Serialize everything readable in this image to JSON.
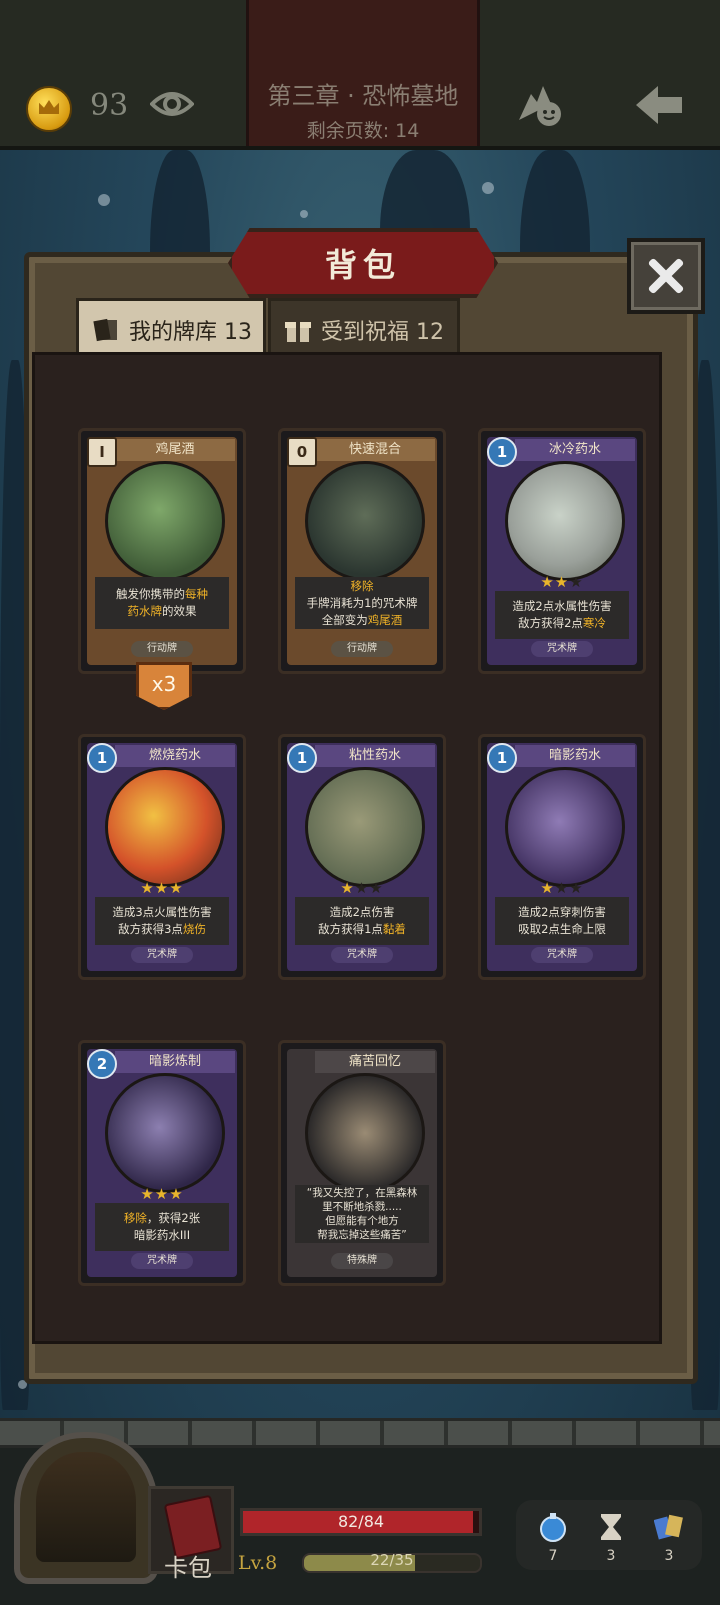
{
  "header": {
    "gold": "93",
    "chapter_title": "第三章 · 恐怖墓地",
    "pages_label": "剩余页数: 14"
  },
  "panel": {
    "title": "背包",
    "tabs": [
      {
        "label": "我的牌库 13",
        "active": true,
        "icon": "cards-icon"
      },
      {
        "label": "受到祝福 12",
        "active": false,
        "icon": "gift-icon"
      }
    ]
  },
  "cards": [
    {
      "name": "鸡尾酒",
      "cost": "I",
      "cost_type": "hourglass",
      "frame": "action",
      "desc_lines": [
        "触发你携带的每种",
        "药水牌的效果"
      ],
      "highlights": [
        "每种",
        "药水牌"
      ],
      "type": "行动牌",
      "stars": null,
      "count": "x3"
    },
    {
      "name": "快速混合",
      "cost": "0",
      "cost_type": "hourglass",
      "frame": "action",
      "desc_lines": [
        "移除",
        "手牌消耗为1的咒术牌",
        "全部变为鸡尾酒"
      ],
      "highlights": [
        "移除",
        "鸡尾酒"
      ],
      "type": "行动牌",
      "stars": null
    },
    {
      "name": "冰冷药水",
      "cost": "1",
      "cost_type": "mana",
      "frame": "spell",
      "desc_lines": [
        "造成2点水属性伤害",
        "敌方获得2点寒冷"
      ],
      "highlights": [
        "寒冷"
      ],
      "type": "咒术牌",
      "stars": 2
    },
    {
      "name": "燃烧药水",
      "cost": "1",
      "cost_type": "mana",
      "frame": "spell",
      "desc_lines": [
        "造成3点火属性伤害",
        "敌方获得3点烧伤"
      ],
      "highlights": [
        "烧伤"
      ],
      "type": "咒术牌",
      "stars": 3
    },
    {
      "name": "粘性药水",
      "cost": "1",
      "cost_type": "mana",
      "frame": "spell",
      "desc_lines": [
        "造成2点伤害",
        "敌方获得1点黏着"
      ],
      "highlights": [
        "黏着"
      ],
      "type": "咒术牌",
      "stars": 1
    },
    {
      "name": "暗影药水",
      "cost": "1",
      "cost_type": "mana",
      "frame": "spell",
      "desc_lines": [
        "造成2点穿刺伤害",
        "吸取2点生命上限"
      ],
      "highlights": [],
      "type": "咒术牌",
      "stars": 1
    },
    {
      "name": "暗影炼制",
      "cost": "2",
      "cost_type": "mana",
      "frame": "spell",
      "desc_lines": [
        "移除，获得2张",
        "暗影药水III"
      ],
      "highlights": [
        "移除"
      ],
      "type": "咒术牌",
      "stars": 3
    },
    {
      "name": "痛苦回忆",
      "cost": "",
      "cost_type": "none",
      "frame": "special",
      "desc_lines": [
        "“我又失控了，在黑森林",
        "里不断地杀戮.....",
        "但愿能有个地方",
        "帮我忘掉这些痛苦”"
      ],
      "highlights": [],
      "type": "特殊牌",
      "stars": null
    }
  ],
  "hud": {
    "deck_label": "卡包",
    "hp_text": "82/84",
    "hp_fraction": 0.976,
    "level": "Lv.8",
    "xp_text": "22/35",
    "xp_fraction": 0.63,
    "resources": [
      {
        "icon": "potion-icon",
        "value": "7"
      },
      {
        "icon": "hourglass-icon",
        "value": "3"
      },
      {
        "icon": "cards-icon",
        "value": "3"
      }
    ]
  }
}
